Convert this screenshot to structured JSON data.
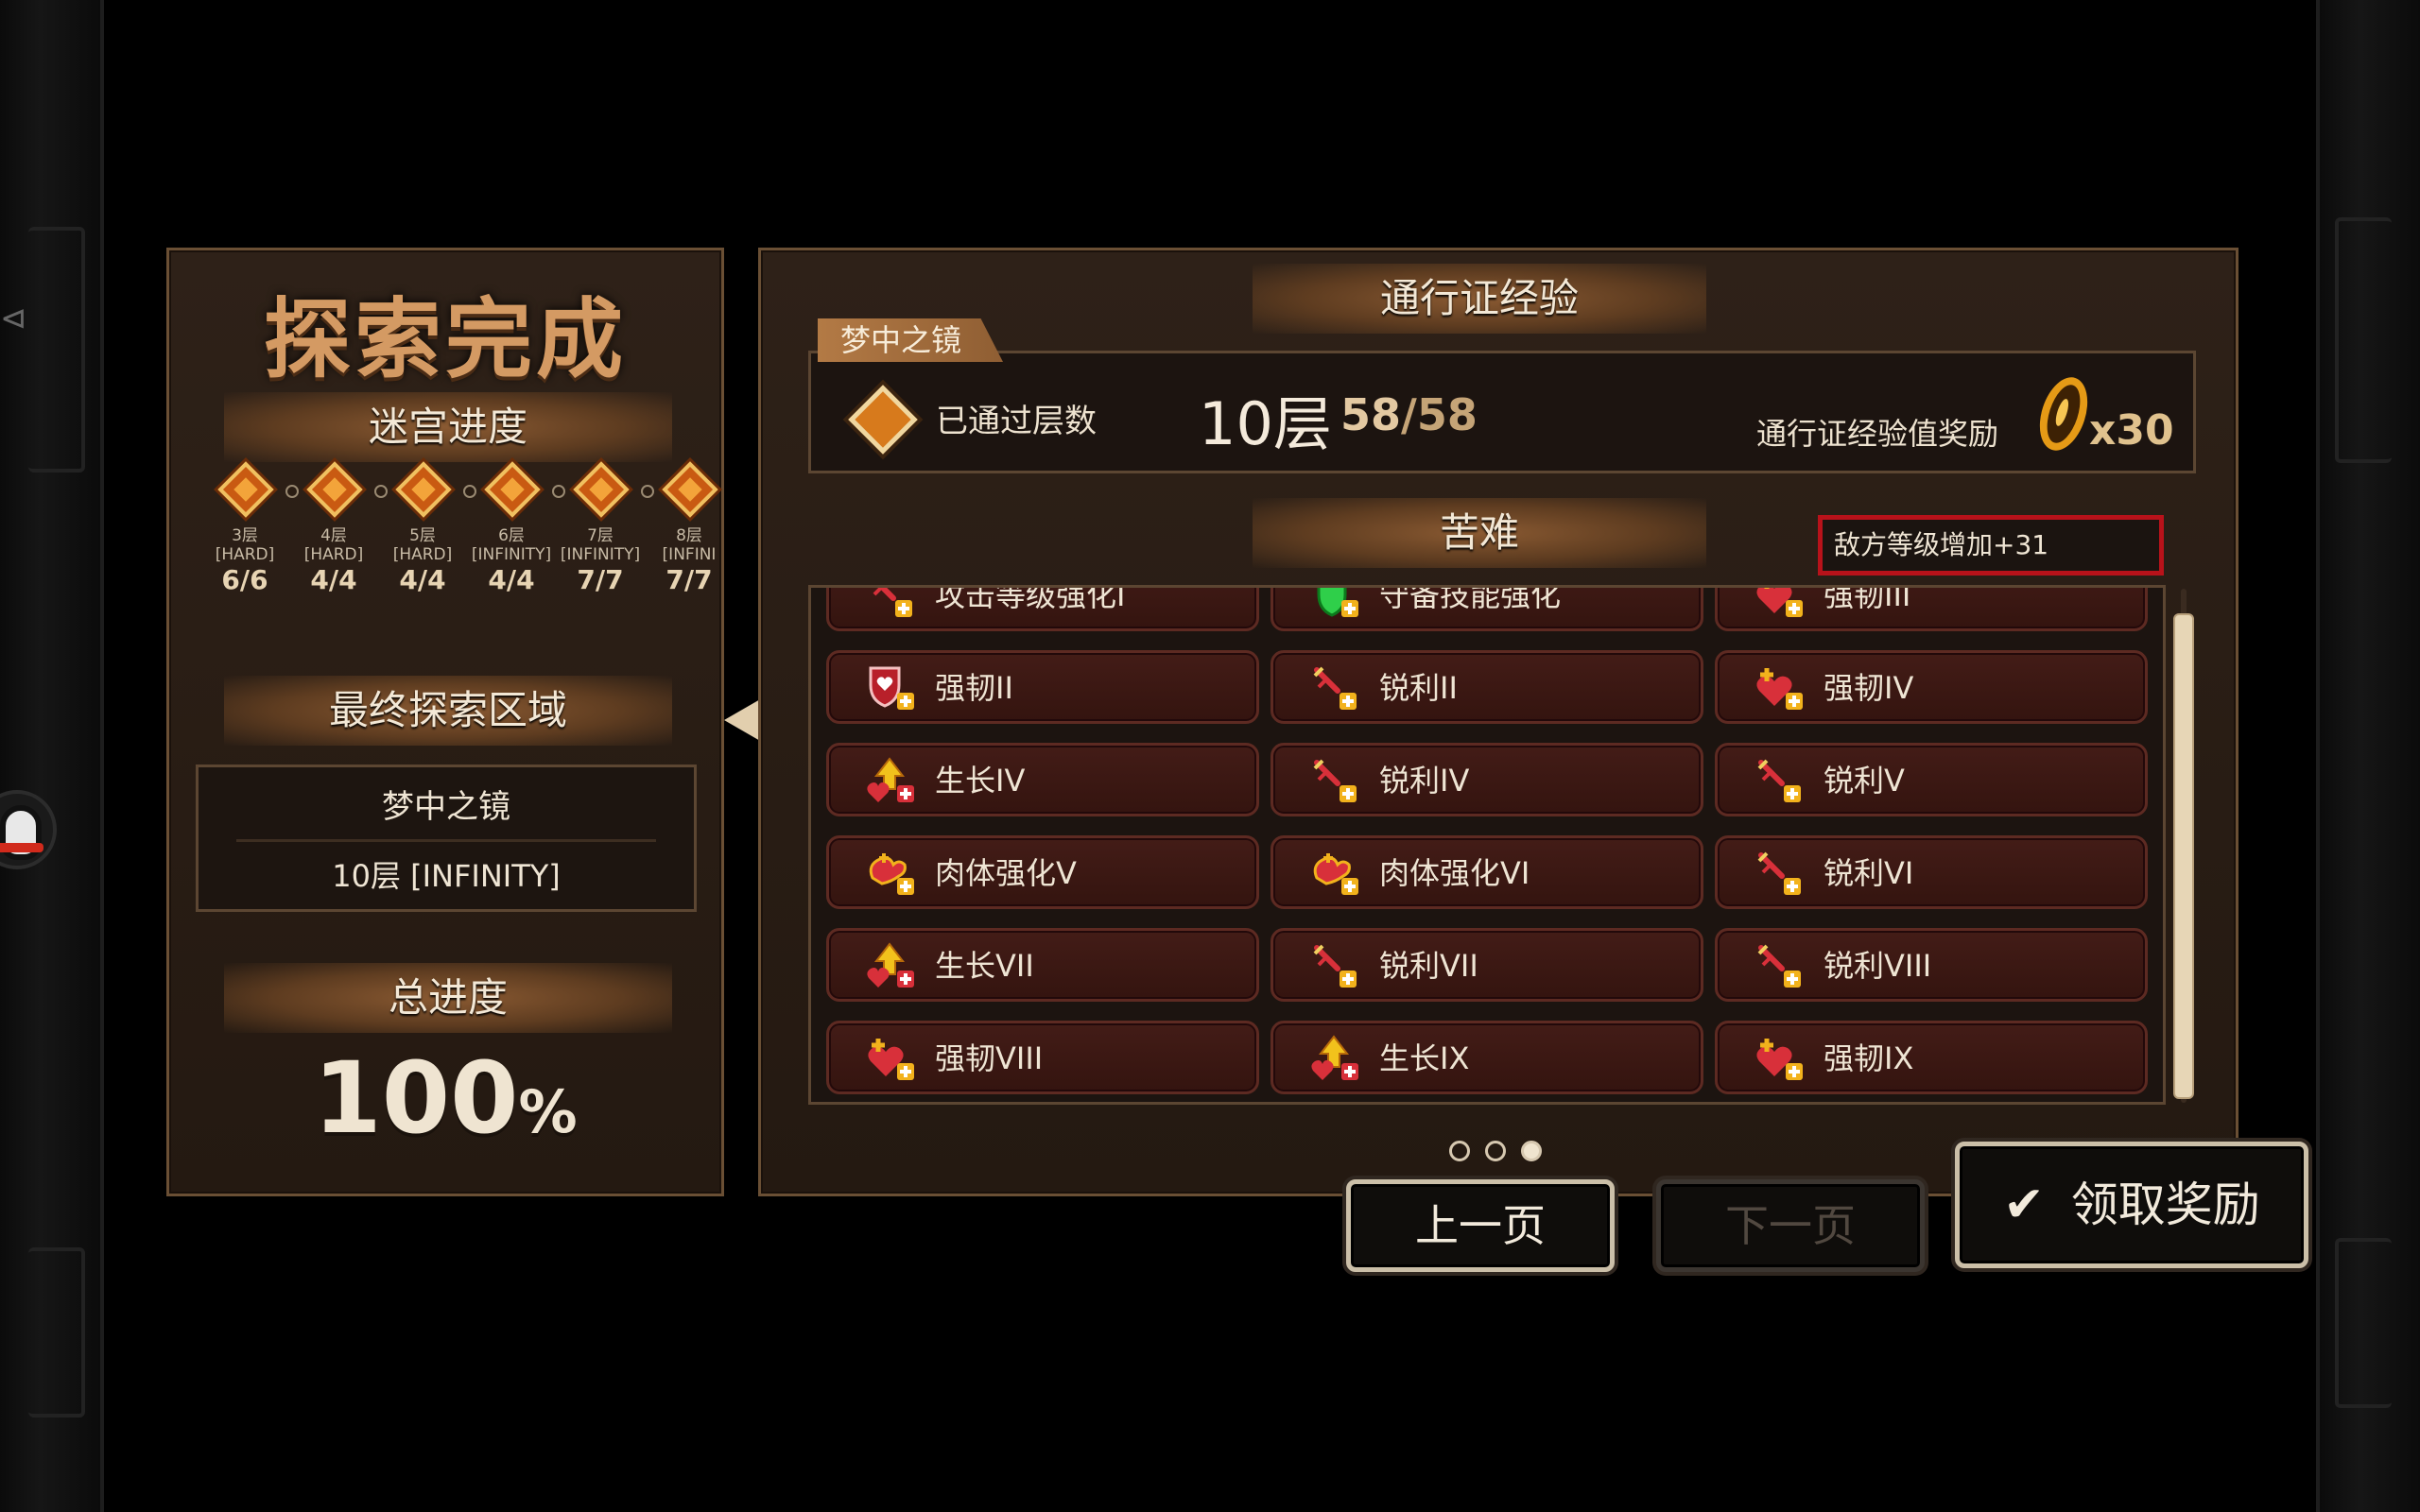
{
  "left": {
    "title": "探索完成",
    "maze_progress_label": "迷宫进度",
    "floors": [
      {
        "name": "3层",
        "mode": "[HARD]",
        "count": "6/6"
      },
      {
        "name": "4层",
        "mode": "[HARD]",
        "count": "4/4"
      },
      {
        "name": "5层",
        "mode": "[HARD]",
        "count": "4/4"
      },
      {
        "name": "6层",
        "mode": "[INFINITY]",
        "count": "4/4"
      },
      {
        "name": "7层",
        "mode": "[INFINITY]",
        "count": "7/7"
      },
      {
        "name": "8层",
        "mode": "[INFINI",
        "count": "7/7"
      }
    ],
    "final_region_label": "最终探索区域",
    "final_region_name": "梦中之镜",
    "final_region_floor": "10层 [INFINITY]",
    "total_progress_label": "总进度",
    "total_progress_value": "100",
    "total_progress_unit": "%"
  },
  "right": {
    "pass_exp_label": "通行证经验",
    "region_tag": "梦中之镜",
    "cleared_floors_label": "已通过层数",
    "cleared_floor": "10层",
    "cleared_count": "58",
    "cleared_max": "/58",
    "pass_reward_label": "通行证经验值奖励",
    "pass_reward_amount": "x30",
    "hardship_label": "苦难",
    "enemy_level_bonus": "敌方等级增加+31",
    "hardships": [
      {
        "label": "攻击等级强化I",
        "icon": "sword-up-icon"
      },
      {
        "label": "守备技能强化",
        "icon": "shield-skill-icon"
      },
      {
        "label": "强韧III",
        "icon": "heart-plus-icon"
      },
      {
        "label": "强韧II",
        "icon": "shield-heart-icon"
      },
      {
        "label": "锐利II",
        "icon": "sword-up-icon"
      },
      {
        "label": "强韧IV",
        "icon": "heart-plus-icon"
      },
      {
        "label": "生长IV",
        "icon": "growth-arrow-icon"
      },
      {
        "label": "锐利IV",
        "icon": "sword-up-icon"
      },
      {
        "label": "锐利V",
        "icon": "sword-up-icon"
      },
      {
        "label": "肉体强化V",
        "icon": "muscle-icon"
      },
      {
        "label": "肉体强化VI",
        "icon": "muscle-icon"
      },
      {
        "label": "锐利VI",
        "icon": "sword-up-icon"
      },
      {
        "label": "生长VII",
        "icon": "growth-arrow-icon"
      },
      {
        "label": "锐利VII",
        "icon": "sword-up-icon"
      },
      {
        "label": "锐利VIII",
        "icon": "sword-up-icon"
      },
      {
        "label": "强韧VIII",
        "icon": "heart-plus-icon"
      },
      {
        "label": "生长IX",
        "icon": "growth-arrow-icon"
      },
      {
        "label": "强韧IX",
        "icon": "heart-plus-icon"
      }
    ],
    "page_total": 3,
    "page_current": 3,
    "scroll_fraction": 0.95
  },
  "buttons": {
    "prev": "上一页",
    "next": "下一页",
    "claim": "领取奖励"
  },
  "colors": {
    "accent_gold": "#d49a63",
    "hardship_red": "#431c17",
    "enemy_border_red": "#b8121a"
  }
}
